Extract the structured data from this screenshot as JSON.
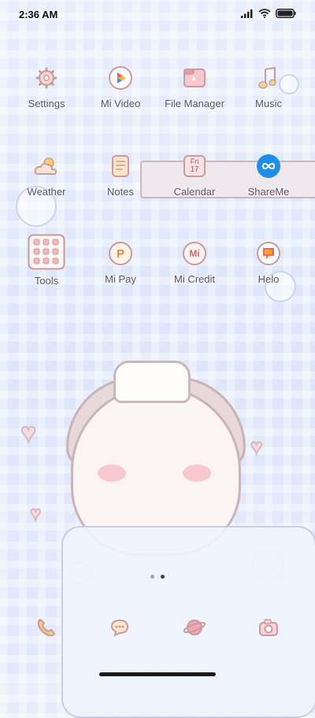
{
  "status_bar": {
    "time": "2:36 AM",
    "battery_level": 1.0
  },
  "apps": [
    {
      "label": "Settings",
      "icon": "settings-gear-icon"
    },
    {
      "label": "Mi Video",
      "icon": "play-triangle-icon"
    },
    {
      "label": "File Manager",
      "icon": "folder-icon"
    },
    {
      "label": "Music",
      "icon": "music-note-icon"
    },
    {
      "label": "Weather",
      "icon": "cloud-sun-icon"
    },
    {
      "label": "Notes",
      "icon": "notepad-icon"
    },
    {
      "label": "Calendar",
      "icon": "calendar-icon",
      "day_name": "Fri",
      "day_number": "17"
    },
    {
      "label": "ShareMe",
      "icon": "infinity-icon"
    },
    {
      "label": "Tools",
      "icon": "tools-grid-icon"
    },
    {
      "label": "Mi Pay",
      "icon": "mi-pay-p-icon",
      "glyph": "P"
    },
    {
      "label": "Mi Credit",
      "icon": "mi-credit-icon",
      "glyph": "Mi"
    },
    {
      "label": "Helo",
      "icon": "helo-icon"
    }
  ],
  "page_indicator": {
    "pages": 2,
    "active_index": 1
  },
  "dock": [
    {
      "icon": "phone-handset-icon"
    },
    {
      "icon": "message-bubble-icon"
    },
    {
      "icon": "browser-planet-icon"
    },
    {
      "icon": "camera-icon"
    }
  ],
  "colors": {
    "accent_blue": "#1e8ee8",
    "pink": "#f36b4f",
    "outline": "#c99b9b"
  }
}
